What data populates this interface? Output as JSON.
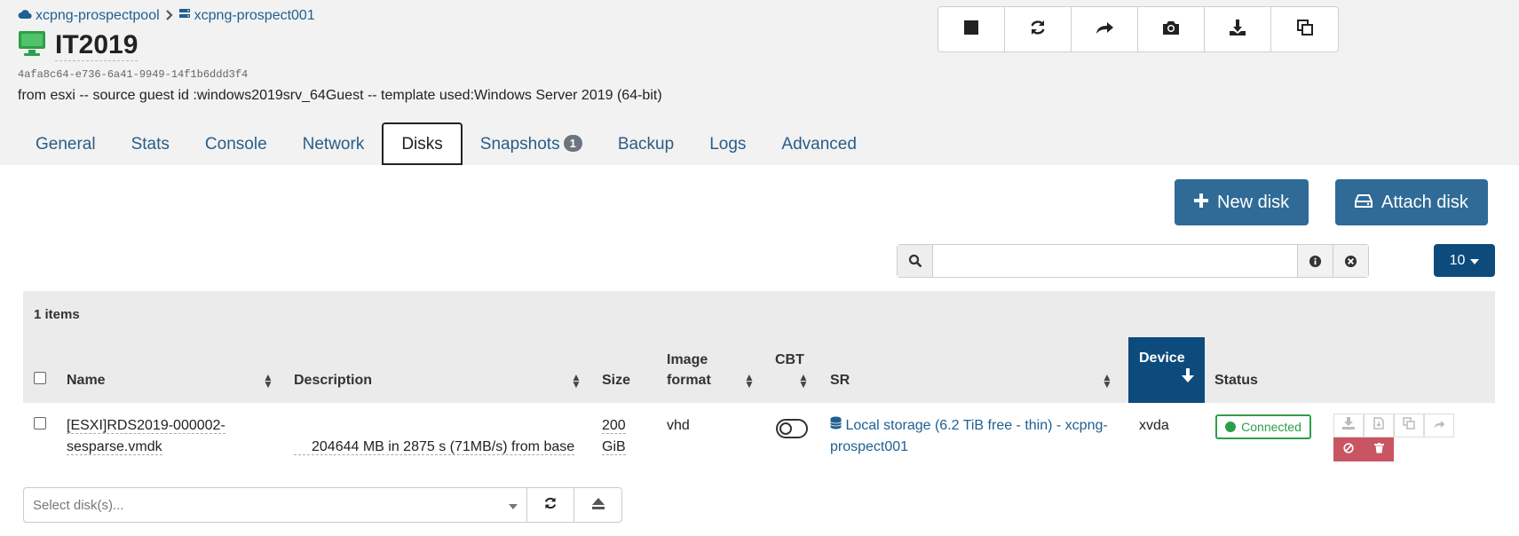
{
  "breadcrumb": {
    "pool": "xcpng-prospectpool",
    "host": "xcpng-prospect001"
  },
  "vm": {
    "name": "IT2019",
    "uuid": "4afa8c64-e736-6a41-9949-14f1b6ddd3f4",
    "description": "from esxi -- source guest id :windows2019srv_64Guest -- template used:Windows Server 2019 (64-bit)"
  },
  "vm_actions": [
    "stop-icon",
    "restart-icon",
    "migrate-icon",
    "snapshot-icon",
    "export-icon",
    "copy-icon"
  ],
  "tabs": [
    {
      "label": "General"
    },
    {
      "label": "Stats"
    },
    {
      "label": "Console"
    },
    {
      "label": "Network"
    },
    {
      "label": "Disks",
      "active": true
    },
    {
      "label": "Snapshots",
      "badge": "1"
    },
    {
      "label": "Backup"
    },
    {
      "label": "Logs"
    },
    {
      "label": "Advanced"
    }
  ],
  "buttons": {
    "new_disk": "New disk",
    "attach_disk": "Attach disk"
  },
  "search": {
    "value": "",
    "placeholder": ""
  },
  "page_size": "10",
  "table": {
    "items_count": "1 items",
    "columns": {
      "name": "Name",
      "description": "Description",
      "size": "Size",
      "image_format_1": "Image",
      "image_format_2": "format",
      "cbt": "CBT",
      "sr": "SR",
      "device": "Device",
      "status": "Status"
    },
    "rows": [
      {
        "name_1": "[ESXI]RDS2019-000002-",
        "name_2": "sesparse.vmdk",
        "description": "204644 MB in 2875 s (71MB/s) from  base",
        "size_1": "200",
        "size_2": "GiB",
        "image_format": "vhd",
        "sr_1": "Local storage (6.2 TiB free - thin) - xcpng-",
        "sr_2": "prospect001",
        "device": "xvda",
        "status": "Connected"
      }
    ]
  },
  "footer": {
    "select_placeholder": "Select disk(s)..."
  },
  "colors": {
    "primary": "#2f6b96",
    "dark_primary": "#0d4b7d",
    "success": "#2e9e4a",
    "danger": "#c95563",
    "link": "#1f5f91"
  }
}
